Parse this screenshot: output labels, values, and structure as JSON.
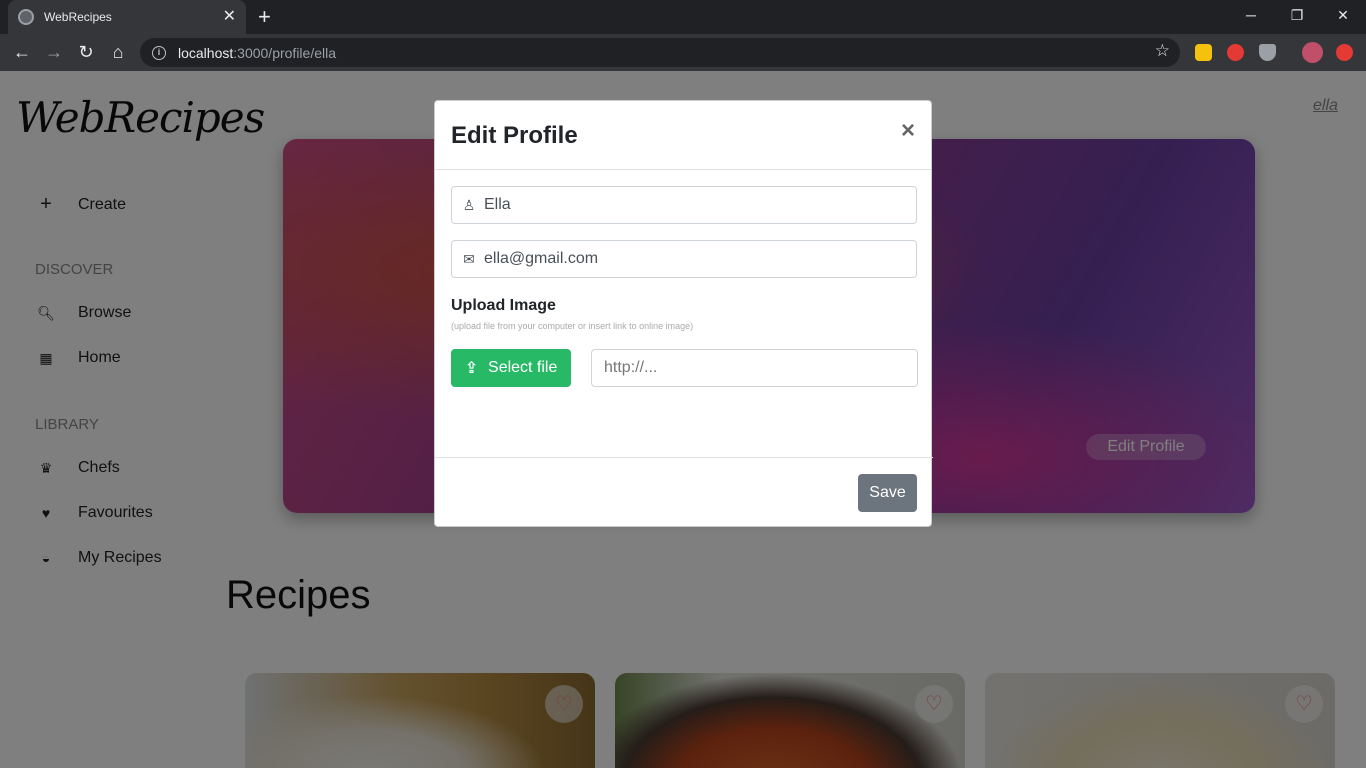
{
  "browser": {
    "tab_title": "WebRecipes",
    "tab_close": "✕",
    "new_tab": "+",
    "url_host": "localhost",
    "url_path": ":3000/profile/ella",
    "minimize": "─",
    "maximize": "❐",
    "close": "✕"
  },
  "sidebar": {
    "logo": "WebRecipes",
    "create_label": "Create",
    "discover_heading": "DISCOVER",
    "library_heading": "LIBRARY",
    "items": [
      {
        "label": "Browse",
        "icon": "search-icon"
      },
      {
        "label": "Home",
        "icon": "grid-icon"
      },
      {
        "label": "Chefs",
        "icon": "chef-hat-icon"
      },
      {
        "label": "Favourites",
        "icon": "heart-icon"
      },
      {
        "label": "My Recipes",
        "icon": "bowl-icon"
      }
    ]
  },
  "header": {
    "username": "ella"
  },
  "banner": {
    "edit_profile_label": "Edit Profile"
  },
  "main": {
    "recipes_title": "Recipes"
  },
  "modal": {
    "title": "Edit Profile",
    "close": "×",
    "name_value": "Ella",
    "email_value": "ella@gmail.com",
    "upload_label": "Upload Image",
    "upload_hint": "(upload file from your computer or insert link to online image)",
    "select_file_label": "Select file",
    "url_placeholder": "http://...",
    "save_label": "Save"
  },
  "colors": {
    "accent_green": "#28b966",
    "save_gray": "#6c757d"
  }
}
